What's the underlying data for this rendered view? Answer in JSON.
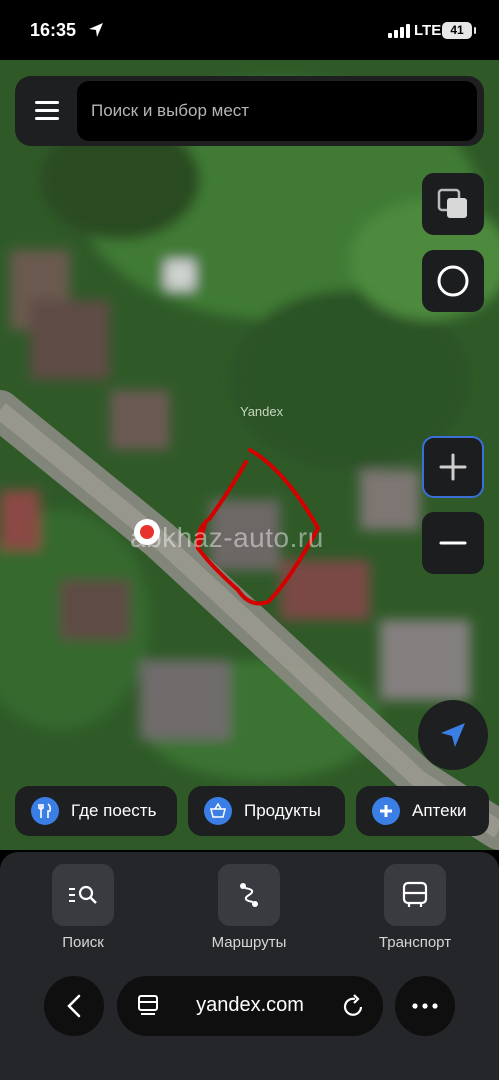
{
  "status_bar": {
    "time": "16:35",
    "network": "LTE",
    "battery": "41"
  },
  "search": {
    "placeholder": "Поиск и выбор мест"
  },
  "map": {
    "brand_mark": "Yandex",
    "watermark": "abkhaz-auto.ru",
    "annotation_color": "#d40000",
    "pin_color": "#e8322c"
  },
  "chips": [
    {
      "label": "Где поесть",
      "icon": "fork-knife-icon"
    },
    {
      "label": "Продукты",
      "icon": "basket-icon"
    },
    {
      "label": "Аптеки",
      "icon": "plus-icon"
    }
  ],
  "bottom_nav": [
    {
      "label": "Поиск",
      "icon": "search-list-icon"
    },
    {
      "label": "Маршруты",
      "icon": "route-icon"
    },
    {
      "label": "Транспорт",
      "icon": "bus-icon"
    }
  ],
  "browser": {
    "url": "yandex.com"
  },
  "colors": {
    "accent": "#3a7ee6",
    "panel": "#25262a"
  }
}
